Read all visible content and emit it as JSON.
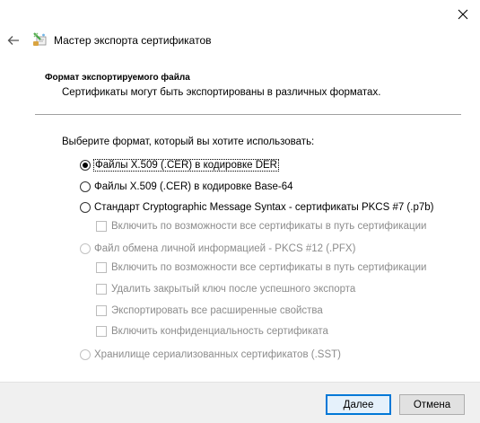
{
  "window": {
    "title": "Мастер экспорта сертификатов",
    "close_icon": "close-icon",
    "back_icon": "back-arrow-icon",
    "wizard_icon": "certificate-wizard-icon"
  },
  "header": {
    "heading": "Формат экспортируемого файла",
    "subheading": "Сертификаты могут быть экспортированы в различных форматах."
  },
  "prompt": "Выберите формат, который вы хотите использовать:",
  "options": {
    "der": {
      "label": "Файлы X.509 (.CER) в кодировке DER",
      "selected": true,
      "enabled": true
    },
    "base64": {
      "label": "Файлы X.509 (.CER) в кодировке Base-64",
      "selected": false,
      "enabled": true
    },
    "p7b": {
      "label": "Стандарт Cryptographic Message Syntax - сертификаты PKCS #7 (.p7b)",
      "selected": false,
      "enabled": true
    },
    "p7b_include_chain": {
      "label": "Включить по возможности все сертификаты в путь сертификации",
      "checked": false,
      "enabled": false
    },
    "pfx": {
      "label": "Файл обмена личной информацией - PKCS #12 (.PFX)",
      "selected": false,
      "enabled": false
    },
    "pfx_include_chain": {
      "label": "Включить по возможности все сертификаты в путь сертификации",
      "checked": false,
      "enabled": false
    },
    "pfx_delete_key": {
      "label": "Удалить закрытый ключ после успешного экспорта",
      "checked": false,
      "enabled": false
    },
    "pfx_export_props": {
      "label": "Экспортировать все расширенные свойства",
      "checked": false,
      "enabled": false
    },
    "pfx_privacy": {
      "label": "Включить конфиденциальность сертификата",
      "checked": false,
      "enabled": false
    },
    "sst": {
      "label": "Хранилище сериализованных сертификатов (.SST)",
      "selected": false,
      "enabled": false
    }
  },
  "buttons": {
    "next": "Далее",
    "cancel": "Отмена"
  },
  "colors": {
    "accent": "#0078d7",
    "disabled_text": "#8c8c8c",
    "footer_bg": "#f0f0f0"
  }
}
